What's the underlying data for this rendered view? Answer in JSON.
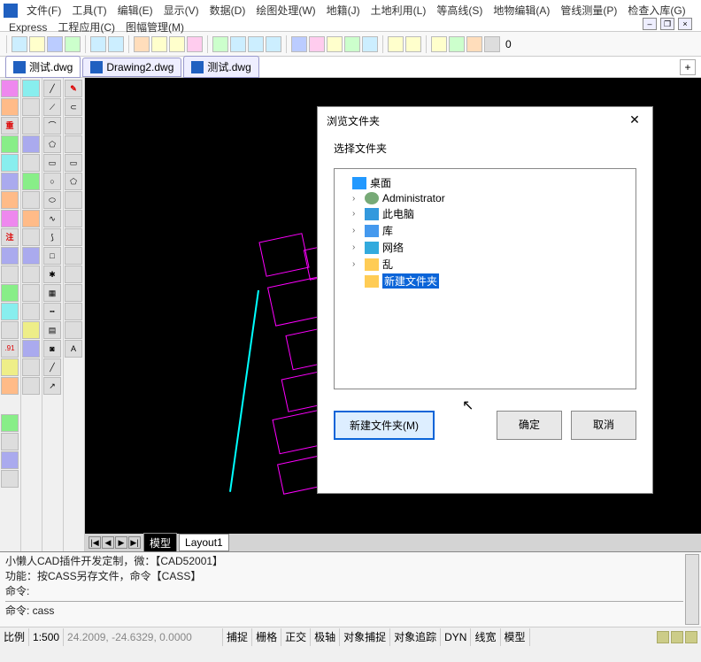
{
  "menus": [
    "文件(F)",
    "工具(T)",
    "编辑(E)",
    "显示(V)",
    "数据(D)",
    "绘图处理(W)",
    "地籍(J)",
    "土地利用(L)",
    "等高线(S)",
    "地物编辑(A)",
    "管线测量(P)",
    "检查入库(G)",
    "Express",
    "工程应用(C)",
    "图幅管理(M)"
  ],
  "toolbar_zero": "0",
  "tabs": [
    {
      "label": "测试.dwg",
      "active": true
    },
    {
      "label": "Drawing2.dwg",
      "active": false
    },
    {
      "label": "测试.dwg",
      "active": false
    }
  ],
  "tool_txt": {
    "zhong": "重",
    "zhu": "注",
    "n91": ".91",
    "a": "A"
  },
  "layout": {
    "model": "模型",
    "layout1": "Layout1"
  },
  "cmd": {
    "l1": "小懒人CAD插件开发定制，微：【CAD52001】",
    "l2": "功能：按CASS另存文件，命令【CASS】",
    "l3": "命令:",
    "l4": "命令: cass"
  },
  "status": {
    "scale_lbl": "比例",
    "scale": "1:500",
    "coords": "24.2009, -24.6329, 0.0000",
    "snap": "捕捉",
    "grid": "栅格",
    "ortho": "正交",
    "polar": "极轴",
    "osnap": "对象捕捉",
    "otrack": "对象追踪",
    "dyn": "DYN",
    "lw": "线宽",
    "model": "模型"
  },
  "dialog": {
    "title": "浏览文件夹",
    "subtitle": "选择文件夹",
    "btn_new": "新建文件夹(M)",
    "btn_ok": "确定",
    "btn_cancel": "取消",
    "tree": {
      "desktop": "桌面",
      "admin": "Administrator",
      "thispc": "此电脑",
      "lib": "库",
      "net": "网络",
      "luan": "乱",
      "newf": "新建文件夹"
    }
  }
}
